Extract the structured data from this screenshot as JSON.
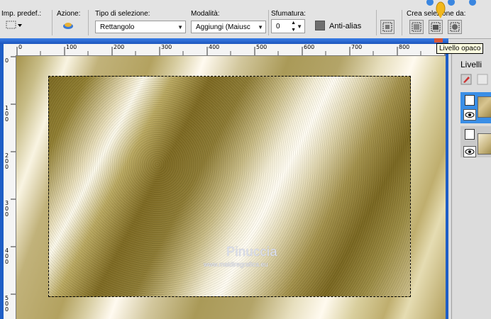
{
  "toolbar": {
    "presets_label": "Imp. predef.:",
    "action_label": "Azione:",
    "selection_type": {
      "label": "Tipo di selezione:",
      "value": "Rettangolo"
    },
    "mode": {
      "label": "Modalità:",
      "value": "Aggiungi (Maiusc"
    },
    "feather": {
      "label": "Sfumatura:",
      "value": "0"
    },
    "antialias": {
      "label": "Anti-alias",
      "checked": false
    },
    "create_selection": {
      "label": "Crea selezione da:",
      "buttons": [
        "layer-selection-icon",
        "layer-opaque-icon",
        "layer-mask-icon"
      ]
    }
  },
  "tooltip": {
    "text": "Livello opaco"
  },
  "document": {
    "ruler_h": [
      "0",
      "100",
      "200",
      "300",
      "400",
      "500",
      "600",
      "700",
      "800"
    ],
    "ruler_v": [
      "0",
      "100",
      "200",
      "300",
      "400",
      "500"
    ],
    "watermark": {
      "name": "Pinuccia",
      "site": "www.maidiregrafica.eu"
    },
    "colors": {
      "dark_gold": "#7c6a22",
      "light_cream": "#fffaf0",
      "frame_gold": "#a5934d"
    }
  },
  "layers": {
    "title": "Livelli",
    "items": [
      {
        "name": "layer-1-raster",
        "selected": true
      },
      {
        "name": "layer-2-background",
        "selected": false
      }
    ]
  }
}
